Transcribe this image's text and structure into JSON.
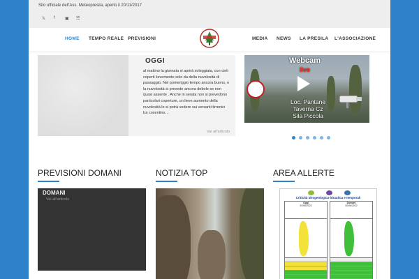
{
  "topbar": {
    "tagline": "Sito ufficiale dell'Ass. Meteopresila, aperto il 20/11/2017",
    "social": [
      "twitter-icon",
      "facebook-icon",
      "instagram-icon",
      "rss-icon"
    ]
  },
  "nav": {
    "items_left": [
      "HOME",
      "TEMPO REALE",
      "PREVISIONI"
    ],
    "items_right": [
      "MEDIA",
      "NEWS",
      "LA PRESILA",
      "L'ASSOCIAZIONE"
    ],
    "active": "HOME"
  },
  "oggi": {
    "title": "OGGI",
    "text": "al mattino la giornata si aprirà soleggiata, con cieli coperti lievemente solo da della nuvolosità di passaggio. Nel pomeriggio tempo ancora buono, e la nuvolosità si prevede ancora debole se non quasi assente . Anche in serata non si prevedono particolari coperture, un lieve aumento della nuvolosità lo si potrà vedere sui versanti tirrenici tra cosentino…",
    "read_more": "Vai all'articolo"
  },
  "webcam": {
    "title": "Webcam",
    "live": "live",
    "location_line1": "Loc. Pantane",
    "location_line2": "Taverna Cz",
    "location_line3": "Sila Piccola",
    "slides": 6,
    "active_slide": 1
  },
  "sections": {
    "previsioni_domani": "PREVISIONI DOMANI",
    "notizia_top": "NOTIZIA TOP",
    "area_allerte": "AREA ALLERTE"
  },
  "domani": {
    "title": "DOMANI",
    "read_more": "Vai all'articolo"
  },
  "allerte": {
    "doc_title": "Criticità idrogeologica-idraulica e temporali",
    "col1_label": "Oggi",
    "col1_date": "29/06/2022",
    "col2_label": "Domani",
    "col2_date": "30/06/2022"
  },
  "colors": {
    "accent": "#2f82c9",
    "background": "#2f82c9",
    "alert_yellow": "#f3e23a",
    "alert_green": "#3fbf3a"
  }
}
